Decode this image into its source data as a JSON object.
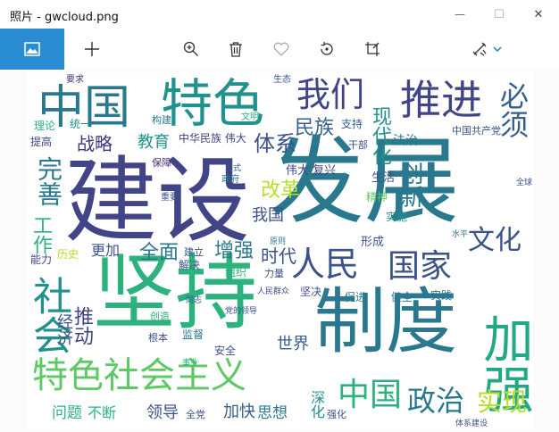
{
  "window": {
    "title": "照片 - gwcloud.png",
    "minimize_glyph": "—",
    "maximize_glyph": "☐",
    "close_glyph": "✕"
  },
  "toolbar": {
    "icons": [
      "gallery-icon",
      "add-icon",
      "zoom-icon",
      "delete-icon",
      "favorite-icon",
      "rotate-icon",
      "crop-icon",
      "edit-icon",
      "chevron-down-icon"
    ]
  },
  "colors": {
    "accent": "#2a8dd4",
    "cloud_palette": [
      "#46327e",
      "#365c8d",
      "#277f8e",
      "#1fa187",
      "#4ac16d",
      "#a0da39",
      "#c8d61b"
    ]
  },
  "wordcloud": {
    "words": [
      {
        "text": "建设",
        "color": "#414487"
      },
      {
        "text": "发展",
        "color": "#2a788e"
      },
      {
        "text": "坚持",
        "color": "#2db27d"
      },
      {
        "text": "制度",
        "color": "#2a788e"
      },
      {
        "text": "中国",
        "color": "#2a788e"
      },
      {
        "text": "特色",
        "color": "#21918c"
      },
      {
        "text": "我们",
        "color": "#414487"
      },
      {
        "text": "推进",
        "color": "#414487"
      },
      {
        "text": "必须",
        "color": "#355f8d"
      },
      {
        "text": "社会",
        "color": "#21918c"
      },
      {
        "text": "人民",
        "color": "#3b528b"
      },
      {
        "text": "国家",
        "color": "#3b528b"
      },
      {
        "text": "文化",
        "color": "#3b528b"
      },
      {
        "text": "加强",
        "color": "#22a884"
      },
      {
        "text": "特色社会主义",
        "color": "#5ec962"
      },
      {
        "text": "中国",
        "color": "#2db27d"
      },
      {
        "text": "政治",
        "color": "#2a788e"
      },
      {
        "text": "实现",
        "color": "#b5de2b"
      },
      {
        "text": "完善",
        "color": "#2a788e"
      },
      {
        "text": "工作",
        "color": "#2db27d"
      },
      {
        "text": "战略",
        "color": "#46327e"
      },
      {
        "text": "体系",
        "color": "#3b528b"
      },
      {
        "text": "民族",
        "color": "#355f8d"
      },
      {
        "text": "现代化",
        "color": "#21918c"
      },
      {
        "text": "创新",
        "color": "#2a788e"
      },
      {
        "text": "改革",
        "color": "#b5de2b"
      },
      {
        "text": "全面",
        "color": "#2a788e"
      },
      {
        "text": "增强",
        "color": "#2a788e"
      },
      {
        "text": "时代",
        "color": "#3b528b"
      },
      {
        "text": "推动",
        "color": "#414487"
      },
      {
        "text": "经济",
        "color": "#3b528b"
      },
      {
        "text": "教育",
        "color": "#21918c"
      },
      {
        "text": "更加",
        "color": "#3b528b"
      },
      {
        "text": "我国",
        "color": "#3b528b"
      },
      {
        "text": "世界",
        "color": "#355f8d"
      },
      {
        "text": "领导",
        "color": "#3b528b"
      },
      {
        "text": "加快",
        "color": "#355f8d"
      },
      {
        "text": "思想",
        "color": "#2a788e"
      },
      {
        "text": "问题",
        "color": "#2db27d"
      },
      {
        "text": "不断",
        "color": "#2db27d"
      },
      {
        "text": "深化",
        "color": "#21918c"
      },
      {
        "text": "提高",
        "color": "#414487"
      },
      {
        "text": "理论",
        "color": "#2db27d"
      },
      {
        "text": "统一",
        "color": "#21918c"
      },
      {
        "text": "中华民族 伟大",
        "color": "#414487"
      },
      {
        "text": "伟大 复兴",
        "color": "#414487"
      },
      {
        "text": "法治",
        "color": "#2a788e"
      },
      {
        "text": "生活",
        "color": "#3b528b"
      },
      {
        "text": "精神",
        "color": "#5ec962"
      },
      {
        "text": "实施",
        "color": "#21918c"
      },
      {
        "text": "形成",
        "color": "#3b528b"
      },
      {
        "text": "能力",
        "color": "#414487"
      },
      {
        "text": "历史",
        "color": "#b5de2b"
      },
      {
        "text": "保障",
        "color": "#46327e"
      },
      {
        "text": "构建",
        "color": "#2a788e"
      },
      {
        "text": "支持",
        "color": "#355f8d"
      },
      {
        "text": "干部",
        "color": "#3b528b"
      },
      {
        "text": "中国共产党",
        "color": "#3b528b"
      },
      {
        "text": "组织",
        "color": "#2db27d"
      },
      {
        "text": "力量",
        "color": "#3b528b"
      },
      {
        "text": "坚决",
        "color": "#3b528b"
      },
      {
        "text": "促进",
        "color": "#2a788e"
      },
      {
        "text": "健全",
        "color": "#2a788e"
      },
      {
        "text": "实践",
        "color": "#2a788e"
      },
      {
        "text": "解决",
        "color": "#3b528b"
      },
      {
        "text": "建立",
        "color": "#3b528b"
      },
      {
        "text": "监督",
        "color": "#2a788e"
      },
      {
        "text": "安全",
        "color": "#3b528b"
      },
      {
        "text": "创造",
        "color": "#2db27d"
      },
      {
        "text": "根本",
        "color": "#3b528b"
      },
      {
        "text": "强化",
        "color": "#3b528b"
      },
      {
        "text": "全党",
        "color": "#3b528b"
      },
      {
        "text": "要求",
        "color": "#46327e"
      },
      {
        "text": "生态",
        "color": "#3b528b"
      },
      {
        "text": "文明",
        "color": "#2db27d"
      },
      {
        "text": "重要",
        "color": "#3b528b"
      },
      {
        "text": "政府",
        "color": "#2a788e"
      },
      {
        "text": "方式",
        "color": "#3b528b"
      },
      {
        "text": "同志",
        "color": "#3b528b"
      },
      {
        "text": "水平",
        "color": "#2a788e"
      },
      {
        "text": "人民群众",
        "color": "#3b528b"
      },
      {
        "text": "党的领导",
        "color": "#3b528b"
      },
      {
        "text": "原则",
        "color": "#2a788e"
      },
      {
        "text": "全球",
        "color": "#3b528b"
      },
      {
        "text": "事业",
        "color": "#2db27d"
      },
      {
        "text": "体系建设",
        "color": "#3b528b"
      }
    ]
  }
}
